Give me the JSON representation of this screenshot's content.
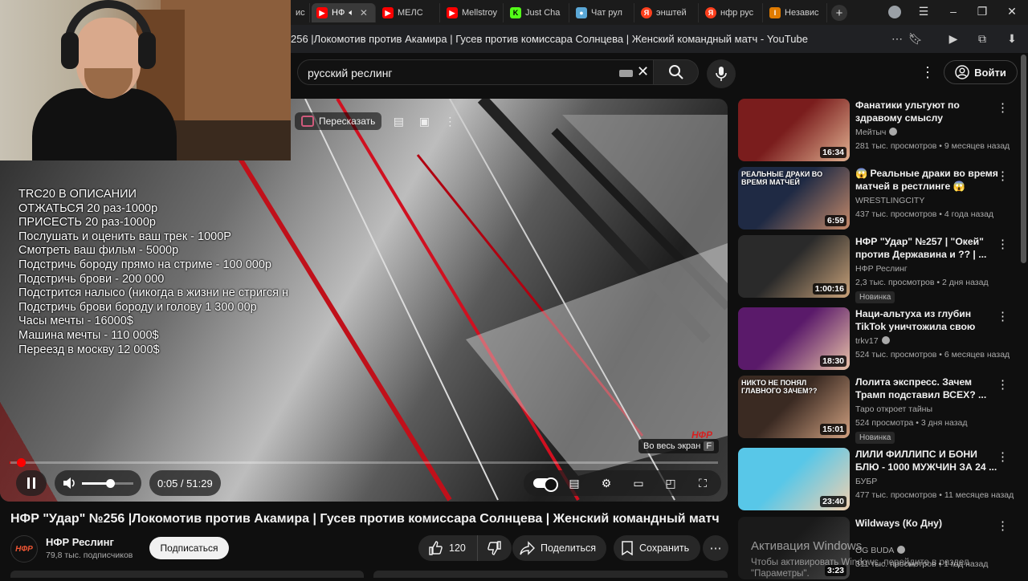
{
  "browser": {
    "tabs": [
      {
        "label": "ис",
        "favicon": "partial",
        "active": false
      },
      {
        "label": "НФ",
        "favicon": "youtube",
        "active": true,
        "audio": true
      },
      {
        "label": "МЕЛС",
        "favicon": "youtube",
        "active": false
      },
      {
        "label": "Mellstroy",
        "favicon": "youtube",
        "active": false
      },
      {
        "label": "Just Cha",
        "favicon": "kick",
        "active": false
      },
      {
        "label": "Чат рул",
        "favicon": "cat",
        "active": false
      },
      {
        "label": "энштей",
        "favicon": "yandex",
        "active": false
      },
      {
        "label": "нфр рус",
        "favicon": "yandex",
        "active": false
      },
      {
        "label": "Независ",
        "favicon": "independent",
        "active": false
      }
    ],
    "page_title": "256 |Локомотив против Акамира | Гусев против комиссара Солнцева | Женский командный матч - YouTube"
  },
  "masthead": {
    "search_value": "русский реслинг",
    "signin_label": "Войти"
  },
  "player": {
    "retell_label": "Пересказать",
    "time_current": "0:05",
    "time_sep": " / ",
    "time_total": "51:29",
    "progress": 0.0016,
    "fullscreen_tip": "Во весь экран",
    "fullscreen_key": "F",
    "channel_watermark": "НФР"
  },
  "stream_overlay": {
    "donation_lines": [
      "TRC20 В ОПИСАНИИ",
      "ОТЖАТЬСЯ 20 раз-1000р",
      "ПРИСЕСТЬ 20 раз-1000р",
      "Послушать и оценить ваш трек - 1000Р",
      "Смотреть ваш фильм - 5000р",
      "Подстричь бороду прямо на стриме - 100 000р",
      "Подстричь брови - 200 000",
      "Подстрится налысо (никогда в жизни не стригся н",
      "Подстричь брови бороду и голову 1 300 00р",
      "Часы мечты - 16000$",
      "Машина мечты - 110 000$",
      "Переезд в москву 12 000$"
    ]
  },
  "video": {
    "title": "НФР \"Удар\" №256 |Локомотив против Акамира | Гусев против комиссара Солнцева | Женский командный матч",
    "channel_name": "НФР Реслинг",
    "channel_avatar_text": "НФР",
    "subscribers": "79,8 тыс. подписчиков",
    "subscribe_label": "Подписаться",
    "likes": "120",
    "share_label": "Поделиться",
    "save_label": "Сохранить"
  },
  "recommendations": [
    {
      "title": "Фанатики ультуют по здравому смыслу",
      "channel": "Мейтыч",
      "verified": true,
      "views": "281 тыс. просмотров",
      "age": "9 месяцев назад",
      "duration": "16:34",
      "is_new": false,
      "thumb_text": "",
      "colors": [
        "#7a1d1d",
        "#e0b090"
      ]
    },
    {
      "title": "😱 Реальные драки во время матчей в рестлинге 😱",
      "channel": "WRESTLINGCITY",
      "verified": false,
      "views": "437 тыс. просмотров",
      "age": "4 года назад",
      "duration": "6:59",
      "is_new": false,
      "thumb_text": "РЕАЛЬНЫЕ ДРАКИ ВО ВРЕМЯ МАТЧЕЙ",
      "colors": [
        "#1f2a44",
        "#c58a6a"
      ]
    },
    {
      "title": "НФР \"Удар\" №257 | \"Окей\" против Державина и ?? | ...",
      "channel": "НФР Реслинг",
      "verified": false,
      "views": "2,3 тыс. просмотров",
      "age": "2 дня назад",
      "duration": "1:00:16",
      "is_new": true,
      "thumb_text": "",
      "colors": [
        "#2a2a2a",
        "#c9a27a"
      ]
    },
    {
      "title": "Наци-альтуха из глубин TikTok уничтожила свою жизнь",
      "channel": "trkv17",
      "verified": true,
      "views": "524 тыс. просмотров",
      "age": "6 месяцев назад",
      "duration": "18:30",
      "is_new": false,
      "thumb_text": "",
      "colors": [
        "#5a1a6a",
        "#e9c3a8"
      ]
    },
    {
      "title": "Лолита экспресс. Зачем Трамп подставил ВСЕХ? ...",
      "channel": "Таро откроет тайны",
      "verified": false,
      "views": "524 просмотра",
      "age": "3 дня назад",
      "duration": "15:01",
      "is_new": true,
      "thumb_text": "НИКТО НЕ ПОНЯЛ ГЛАВНОГО ЗАЧЕМ??",
      "colors": [
        "#3a2a22",
        "#d0a080"
      ]
    },
    {
      "title": "ЛИЛИ ФИЛЛИПС И БОНИ БЛЮ - 1000 МУЖЧИН ЗА 24 ...",
      "channel": "БУБР",
      "verified": false,
      "views": "477 тыс. просмотров",
      "age": "11 месяцев назад",
      "duration": "23:40",
      "is_new": false,
      "thumb_text": "",
      "colors": [
        "#58c7e8",
        "#f0d0b0"
      ]
    },
    {
      "title": "Wildways (Ко Дну)",
      "channel": "OG BUDA",
      "verified": true,
      "views": "311 тыс. просмотров",
      "age": "1 год назад",
      "duration": "3:23",
      "is_new": false,
      "thumb_text": "",
      "colors": [
        "#1a1a1a",
        "#444444"
      ]
    }
  ],
  "windows_watermark": {
    "line1": "Активация Windows",
    "line2": "Чтобы активировать Windows, перейдите в раздел \"Параметры\"."
  },
  "theme": {
    "accent": "#ff0000",
    "background": "#0f0f0f",
    "text": "#f1f1f1",
    "muted": "#aaaaaa"
  }
}
